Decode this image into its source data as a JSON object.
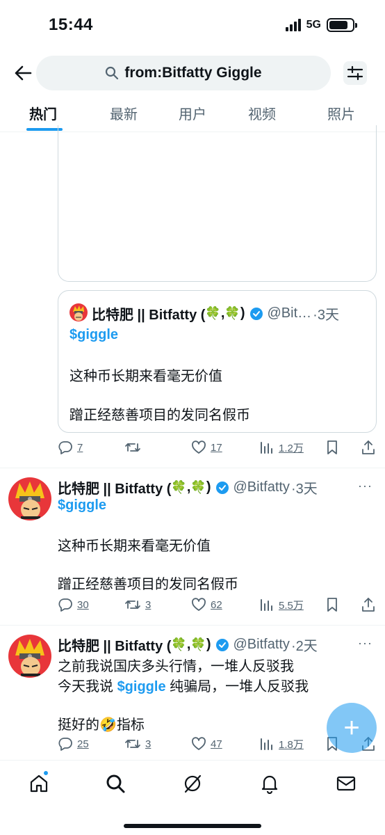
{
  "status": {
    "time": "15:44",
    "network": "5G"
  },
  "search": {
    "query": "from:Bitfatty Giggle"
  },
  "tabs": [
    "热门",
    "最新",
    "用户",
    "视频",
    "照片"
  ],
  "quote": {
    "name": "比特肥 || Bitfatty (",
    "name_end": ")",
    "handle": "@Bit…",
    "time": "·3天",
    "cashtag": "$giggle",
    "line1": "这种币长期来看毫无价值",
    "line2": "蹭正经慈善项目的发同名假币"
  },
  "post1_actions": {
    "replies": "7",
    "reposts": "",
    "likes": "17",
    "views": "1.2万"
  },
  "post2": {
    "name": "比特肥 || Bitfatty (",
    "name_end": ")",
    "handle": "@Bitfatty",
    "time": "·3天",
    "cashtag": "$giggle",
    "line1": "这种币长期来看毫无价值",
    "line2": "蹭正经慈善项目的发同名假币",
    "replies": "30",
    "reposts": "3",
    "likes": "62",
    "views": "5.5万"
  },
  "post3": {
    "name": "比特肥 || Bitfatty (",
    "name_end": ")",
    "handle": "@Bitfatty",
    "time": "·2天",
    "line1": "之前我说国庆多头行情，一堆人反驳我",
    "line2_pre": "今天我说 ",
    "cashtag": "$giggle",
    "line2_post": " 纯骗局，一堆人反驳我",
    "line3_pre": "挺好的",
    "emoji": "🤣",
    "line3_post": "指标",
    "replies": "25",
    "reposts": "3",
    "likes": "47",
    "views": "1.8万"
  },
  "colors": {
    "accent": "#1d9bf0",
    "text": "#0f1419",
    "muted": "#536471",
    "clover": "#36b34a"
  },
  "icons": [
    "back-arrow-icon",
    "search-icon",
    "filter-icon",
    "reply-icon",
    "repost-icon",
    "like-icon",
    "views-icon",
    "bookmark-icon",
    "share-icon",
    "verified-icon",
    "home-icon",
    "explore-icon",
    "grok-icon",
    "notifications-icon",
    "messages-icon",
    "compose-icon"
  ]
}
